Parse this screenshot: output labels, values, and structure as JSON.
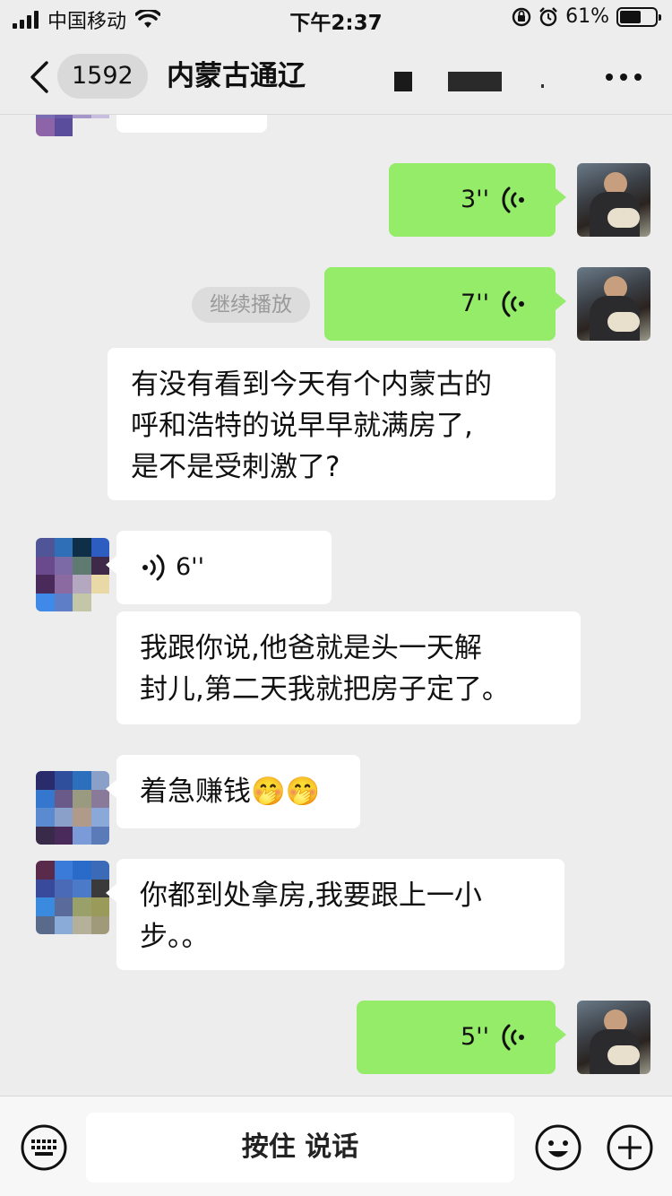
{
  "status_bar": {
    "carrier": "中国移动",
    "time": "下午2:37",
    "battery": "61%",
    "battery_level": 0.61
  },
  "header": {
    "back_count": "1592",
    "title": "内蒙古通辽"
  },
  "messages": [
    {
      "id": "m0",
      "side": "in",
      "type": "text",
      "text": ""
    },
    {
      "id": "m1",
      "side": "out",
      "type": "voice",
      "duration": "3''"
    },
    {
      "id": "m2",
      "side": "out",
      "type": "voice",
      "duration": "7''",
      "action": "继续播放"
    },
    {
      "id": "m3",
      "side": "in",
      "type": "text",
      "text": "有没有看到今天有个内蒙古的\n呼和浩特的说早早就满房了,\n是不是受刺激了?"
    },
    {
      "id": "m4",
      "side": "in",
      "type": "voice",
      "duration": "6''"
    },
    {
      "id": "m5",
      "side": "in",
      "type": "text",
      "text": "我跟你说,他爸就是头一天解\n封儿,第二天我就把房子定了。"
    },
    {
      "id": "m6",
      "side": "in",
      "type": "text",
      "text": "着急赚钱🤭🤭"
    },
    {
      "id": "m7",
      "side": "in",
      "type": "text",
      "text": "你都到处拿房,我要跟上一小\n步。。"
    },
    {
      "id": "m8",
      "side": "out",
      "type": "voice",
      "duration": "5''"
    }
  ],
  "input_bar": {
    "hold_to_talk": "按住 说话"
  },
  "icons": {
    "back": "chevron-left-icon",
    "more": "more-dots-icon",
    "voice": "voice-wave-icon",
    "keyboard": "keyboard-icon",
    "emoji": "emoji-icon",
    "plus": "plus-icon"
  },
  "colors": {
    "outgoing_bubble": "#95ec69",
    "incoming_bubble": "#ffffff",
    "background": "#ededed"
  }
}
